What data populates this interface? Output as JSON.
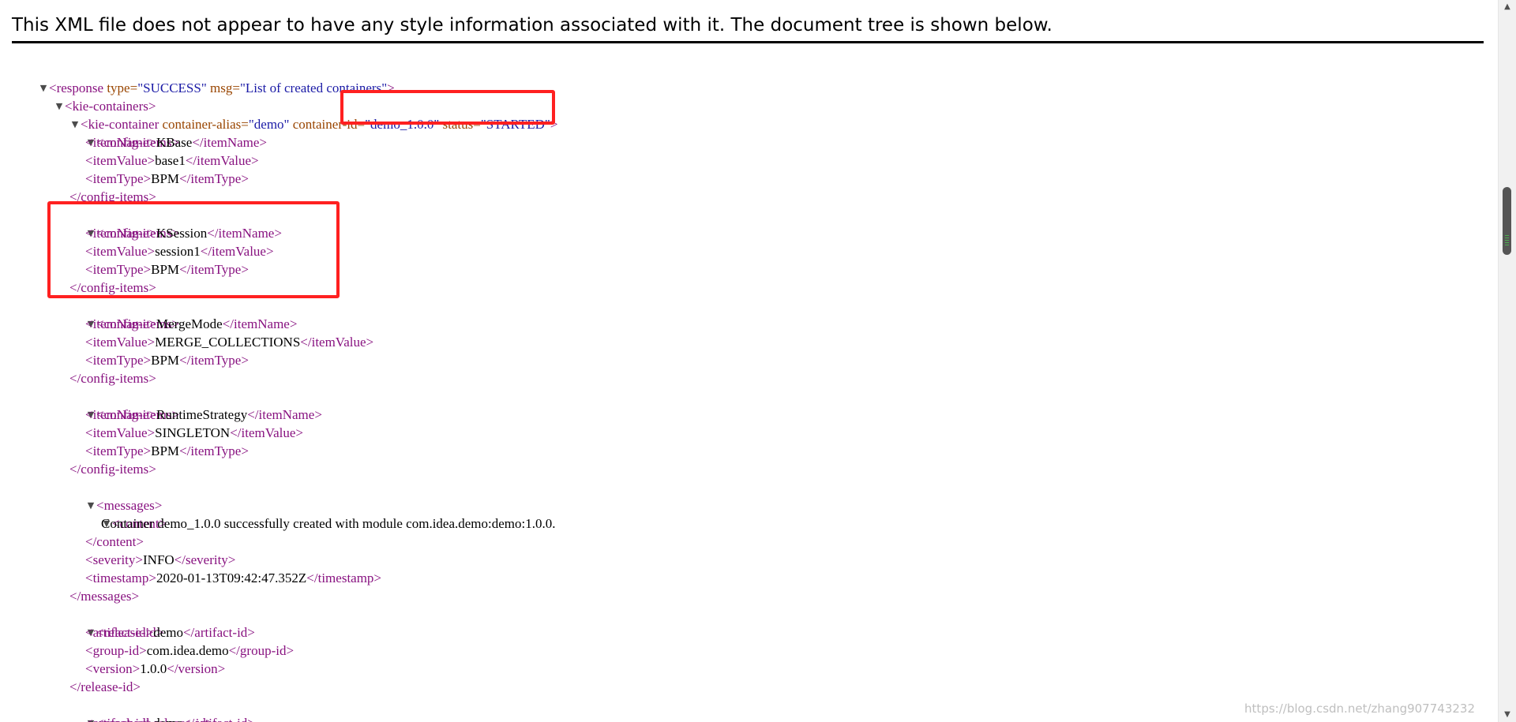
{
  "page": {
    "header": "This XML file does not appear to have any style information associated with it. The document tree is shown below.",
    "watermark": "https://blog.csdn.net/zhang907743232"
  },
  "toggle_glyph": "▼",
  "xml": {
    "response": {
      "open_tag": "<response",
      "type_attr": "type=",
      "type_value": "\"SUCCESS\"",
      "msg_attr": "msg=",
      "msg_value": "\"List of created containers\"",
      "end": ">"
    },
    "kie_containers_open": "<kie-containers>",
    "kie_container": {
      "open_tag": "<kie-container",
      "alias_attr": "container-alias=",
      "alias_value": "\"demo\"",
      "id_attr": "container-id=",
      "id_value": "\"demo_1.0.0\"",
      "status_attr": "status=",
      "status_value": "\"STARTED\"",
      "end": ">"
    },
    "config_items_open": "<config-items>",
    "config_items_close": "</config-items>",
    "config_items": [
      {
        "name_open": "<itemName>",
        "name": "KBase",
        "name_close": "</itemName>",
        "value_open": "<itemValue>",
        "value": "base1",
        "value_close": "</itemValue>",
        "type_open": "<itemType>",
        "type": "BPM",
        "type_close": "</itemType>"
      },
      {
        "name_open": "<itemName>",
        "name": "KSession",
        "name_close": "</itemName>",
        "value_open": "<itemValue>",
        "value": "session1",
        "value_close": "</itemValue>",
        "type_open": "<itemType>",
        "type": "BPM",
        "type_close": "</itemType>"
      },
      {
        "name_open": "<itemName>",
        "name": "MergeMode",
        "name_close": "</itemName>",
        "value_open": "<itemValue>",
        "value": "MERGE_COLLECTIONS",
        "value_close": "</itemValue>",
        "type_open": "<itemType>",
        "type": "BPM",
        "type_close": "</itemType>"
      },
      {
        "name_open": "<itemName>",
        "name": "RuntimeStrategy",
        "name_close": "</itemName>",
        "value_open": "<itemValue>",
        "value": "SINGLETON",
        "value_close": "</itemValue>",
        "type_open": "<itemType>",
        "type": "BPM",
        "type_close": "</itemType>"
      }
    ],
    "messages": {
      "open": "<messages>",
      "content_open": "<content>",
      "content_text": "Container demo_1.0.0 successfully created with module com.idea.demo:demo:1.0.0.",
      "content_close": "</content>",
      "severity_open": "<severity>",
      "severity": "INFO",
      "severity_close": "</severity>",
      "timestamp_open": "<timestamp>",
      "timestamp": "2020-01-13T09:42:47.352Z",
      "timestamp_close": "</timestamp>",
      "close": "</messages>"
    },
    "release_id": {
      "open": "<release-id>",
      "artifact_open": "<artifact-id>",
      "artifact": "demo",
      "artifact_close": "</artifact-id>",
      "group_open": "<group-id>",
      "group": "com.idea.demo",
      "group_close": "</group-id>",
      "version_open": "<version>",
      "version": "1.0.0",
      "version_close": "</version>",
      "close": "</release-id>"
    },
    "resolved_release_id": {
      "open": "<resolved-release-id>",
      "artifact_open": "<artifact-id>",
      "artifact": "demo",
      "artifact_close": "</artifact-id>"
    }
  },
  "scrollbar": {
    "up_glyph": "▲",
    "down_glyph": "▼"
  }
}
